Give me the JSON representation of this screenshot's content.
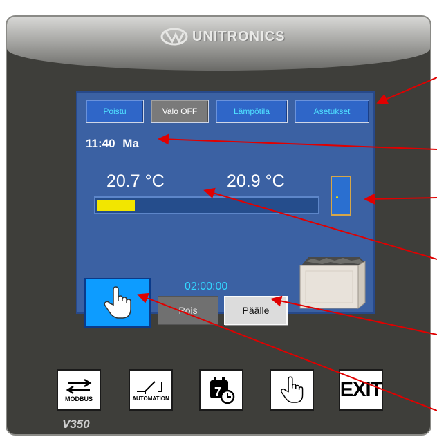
{
  "device": {
    "brand": "UNITRONICS",
    "model": "V350"
  },
  "screen": {
    "toolbar": [
      "Poistu",
      "Valo OFF",
      "Lämpötila",
      "Asetukset"
    ],
    "time": "11:40",
    "day": "Ma",
    "temp_left": "20.7 °C",
    "temp_right": "20.9 °C",
    "temperature_bar_fraction": 0.17,
    "timer": "02:00:00",
    "btn_off": "Pois",
    "btn_on": "Päälle"
  },
  "keys": {
    "modbus": "MODBUS",
    "automation": "AUTOMATION",
    "exit": "EXIT"
  },
  "icons": [
    "unitronics-logo-icon",
    "door-icon",
    "hand-pointer-icon",
    "sauna-stove-icon",
    "modbus-arrows-icon",
    "switch-icon",
    "calendar-clock-icon"
  ],
  "colors": {
    "screen": "#3b61a3",
    "button": "#2f66c8",
    "button_text": "#4fe0ff",
    "bar_fill": "#f2e600",
    "hand_button": "#0d9cff",
    "annotation_arrow": "#e00000"
  }
}
